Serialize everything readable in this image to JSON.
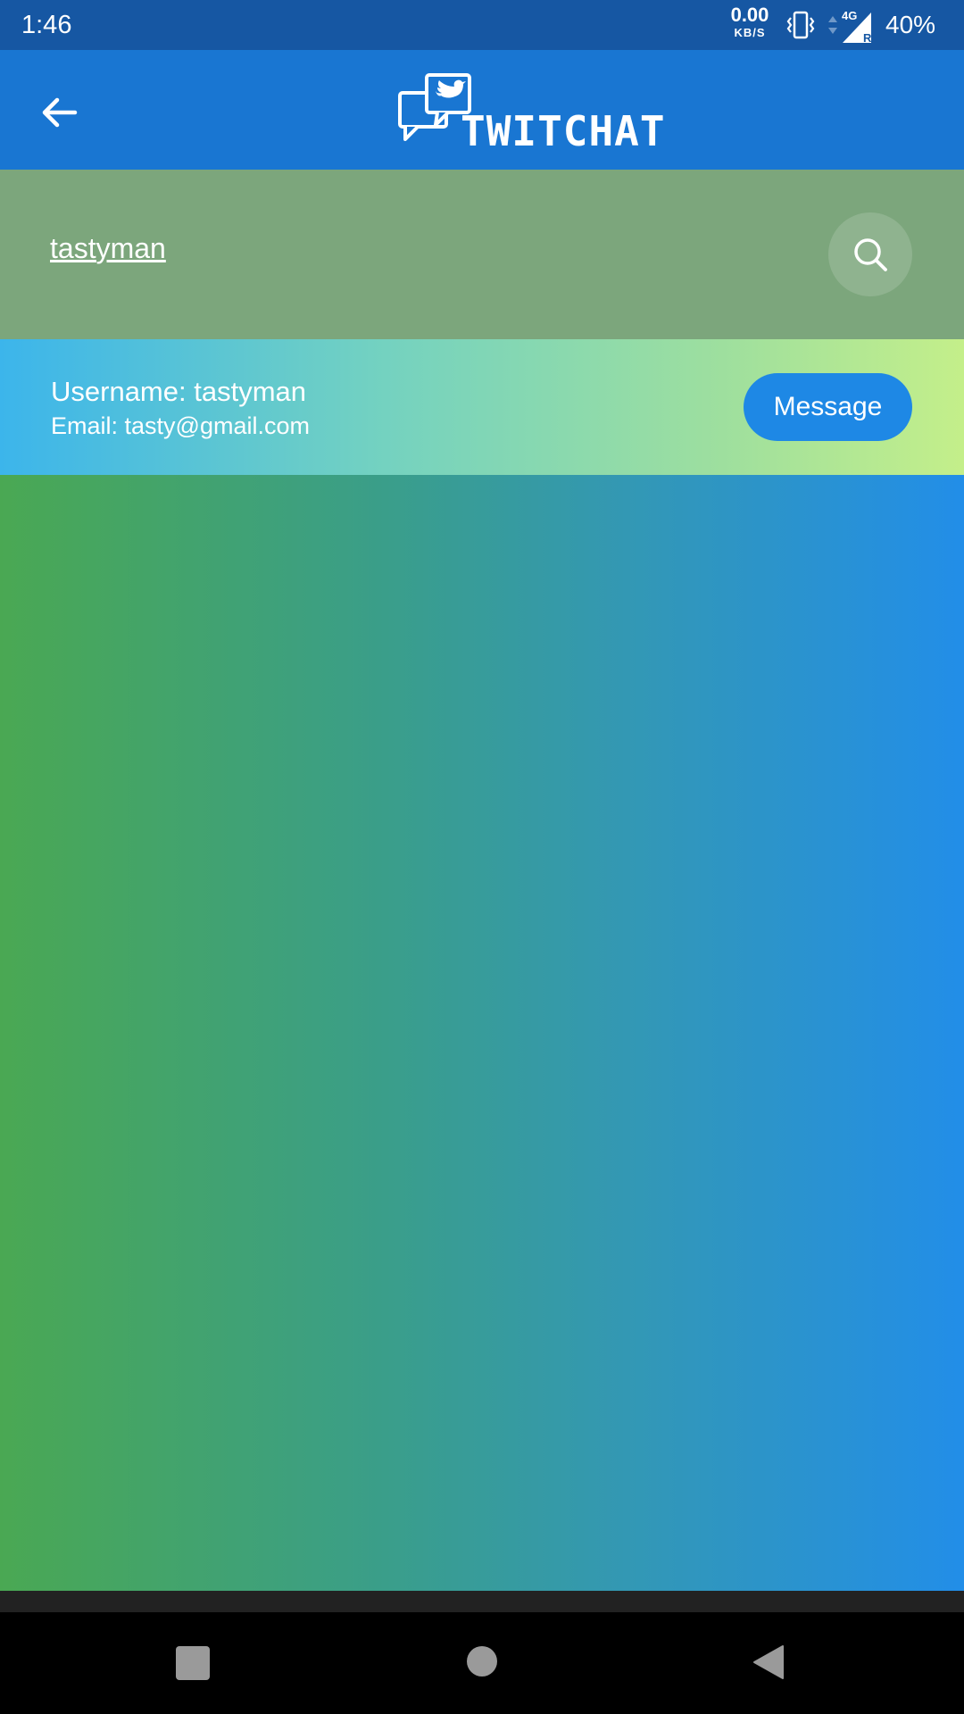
{
  "status_bar": {
    "time": "1:46",
    "net_speed_value": "0.00",
    "net_speed_unit": "KB/S",
    "network_type": "4G",
    "roaming": "R",
    "battery": "40%",
    "icons": [
      "vibrate-icon",
      "data-arrows-icon",
      "signal-icon"
    ]
  },
  "app_bar": {
    "logo_text": "TWITCHAT",
    "icons": [
      "back-arrow-icon",
      "chat-bubbles-bird-icon"
    ],
    "color": "#1976d2"
  },
  "search": {
    "query": "tastyman",
    "icon": "search-icon"
  },
  "result": {
    "username_line": "Username: tastyman",
    "email_line": "Email: tasty@gmail.com",
    "message_label": "Message"
  },
  "nav_bar": {
    "icons": [
      "recents-square-icon",
      "home-circle-icon",
      "back-triangle-icon"
    ]
  },
  "colors": {
    "status_bar": "#1657a3",
    "search_panel": "#7ca67c",
    "message_button": "#1e88e5",
    "gradient_start": "#4aa853",
    "gradient_end": "#228ee8"
  }
}
